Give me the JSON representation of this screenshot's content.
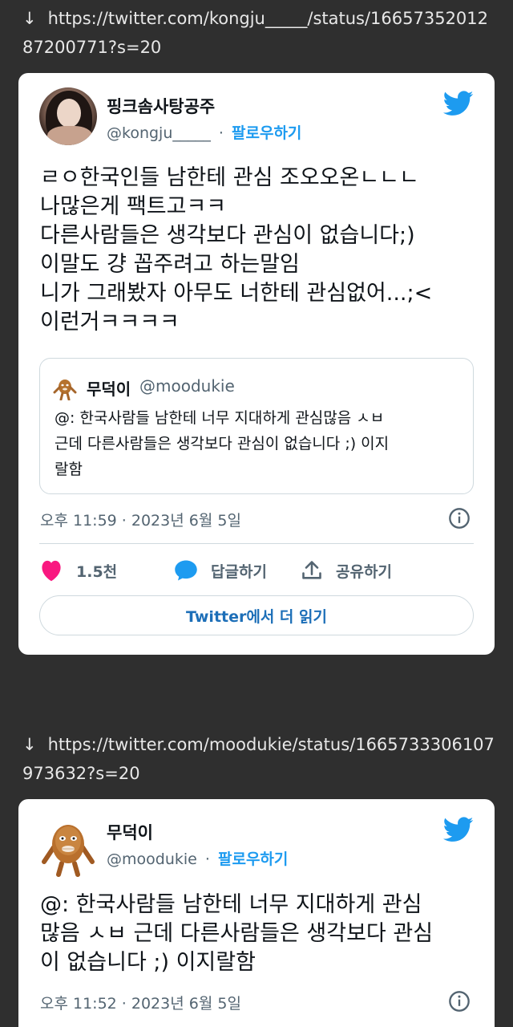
{
  "link1": {
    "arrow": "↓",
    "url": "https://twitter.com/kongju_____/status/1665735201287200771?s=20"
  },
  "tweet1": {
    "name": "핑크솜사탕공주",
    "handle": "@kongju_____",
    "separator": "·",
    "follow_label": "팔로우하기",
    "text": "ㄹㅇ한국인들 남한테 관심 조오오온ㄴㄴㄴ\n나많은게 팩트고ㅋㅋ\n다른사람들은 생각보다 관심이 없습니다;)\n이말도 걍 꼽주려고 하는말임\n니가 그래봤자 아무도 너한테 관심없어...;<\n이런거ㅋㅋㅋㅋ",
    "quote": {
      "name": "무덕이",
      "handle": "@moodukie",
      "text": "@: 한국사람들 남한테 너무 지대하게 관심많음 ㅅㅂ\n근데 다른사람들은 생각보다 관심이 없습니다 ;) 이지\n랄함"
    },
    "timestamp": "오후 11:59 · 2023년 6월 5일",
    "likes": "1.5천",
    "reply_label": "답글하기",
    "share_label": "공유하기",
    "read_more": "Twitter에서 더 읽기"
  },
  "link2": {
    "arrow": "↓",
    "url": "https://twitter.com/moodukie/status/1665733306107973632?s=20"
  },
  "tweet2": {
    "name": "무덕이",
    "handle": "@moodukie",
    "separator": "·",
    "follow_label": "팔로우하기",
    "text": "@: 한국사람들 남한테 너무 지대하게 관심\n많음 ㅅㅂ 근데 다른사람들은 생각보다 관심\n이 없습니다 ;) 이지랄함",
    "timestamp": "오후 11:52 · 2023년 6월 5일"
  },
  "colors": {
    "background": "#2f2f2f",
    "twitter_blue": "#1d9bf0",
    "like_pink": "#f91880",
    "muted": "#536471"
  }
}
